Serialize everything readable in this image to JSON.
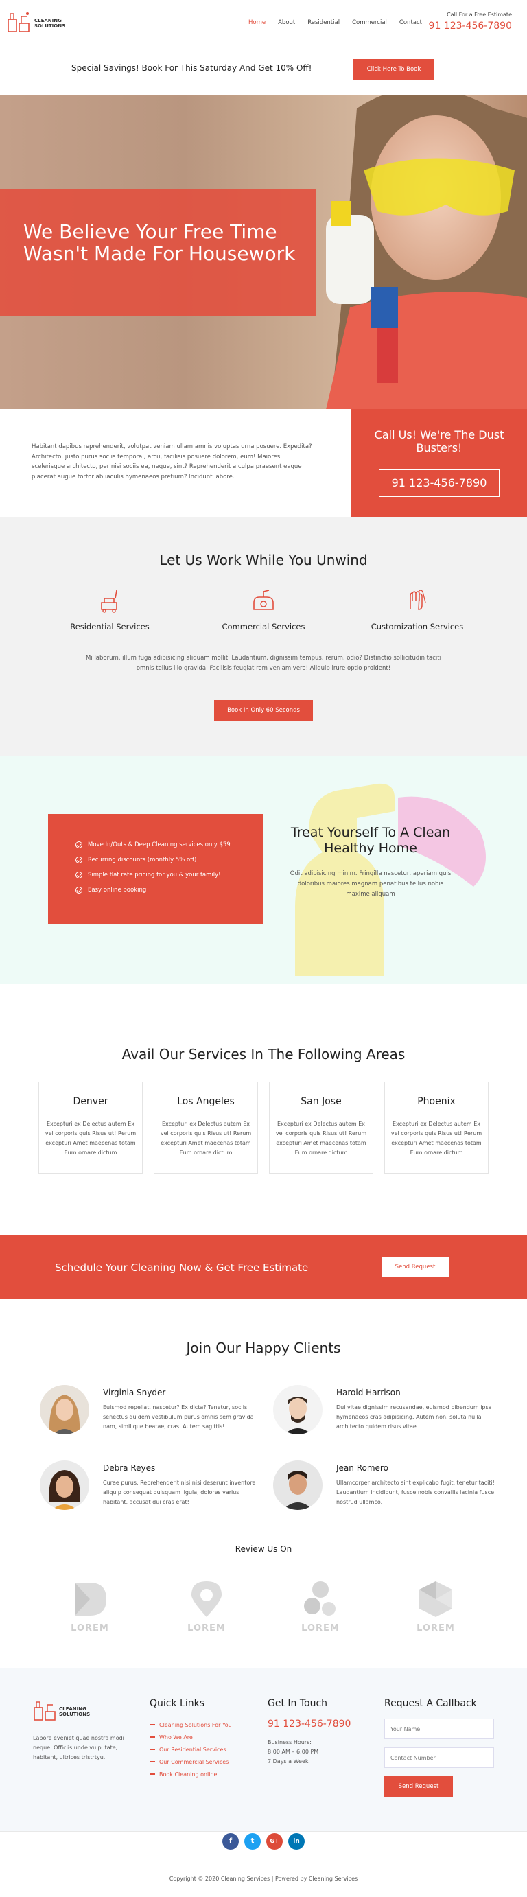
{
  "header": {
    "logo_line1": "CLEANING",
    "logo_line2": "SOLUTIONS",
    "nav": [
      "Home",
      "About",
      "Residential",
      "Commercial",
      "Contact"
    ],
    "active_nav": "Home",
    "call_label": "Call For a Free Estimate",
    "call_phone": "91 123-456-7890"
  },
  "promo": {
    "text": "Special Savings! Book For This Saturday And Get 10% Off!",
    "button": "Click Here To Book"
  },
  "hero": {
    "title": "We Believe Your Free Time Wasn't Made For Housework"
  },
  "intro": {
    "text": "Habitant dapibus reprehenderit, volutpat veniam ullam amnis voluptas urna posuere. Expedita? Architecto, justo purus sociis temporal, arcu, facilisis posuere dolorem, eum! Maiores scelerisque architecto, per nisi sociis ea, neque, sint? Reprehenderit a culpa praesent eaque placerat augue tortor ab iaculis hymenaeos pretium? Incidunt labore.",
    "dust_title": "Call Us! We're The Dust Busters!",
    "dust_phone": "91 123-456-7890"
  },
  "services": {
    "title": "Let Us Work While You Unwind",
    "items": [
      {
        "label": "Residential Services",
        "icon": "vacuum-icon"
      },
      {
        "label": "Commercial Services",
        "icon": "floor-cleaner-icon"
      },
      {
        "label": "Customization Services",
        "icon": "gloves-icon"
      }
    ],
    "description": "Mi laborum, illum fuga adipisicing aliquam mollit. Laudantium, dignissim tempus, rerum, odio? Distinctio sollicitudin taciti omnis tellus illo gravida. Facilisis feugiat rem veniam vero! Aliquip irure optio proident!",
    "button": "Book In Only 60 Seconds"
  },
  "treat": {
    "list": [
      "Move In/Outs & Deep Cleaning services only $59",
      "Recurring discounts (monthly 5% off)",
      "Simple flat rate pricing for you & your family!",
      "Easy online booking"
    ],
    "title": "Treat Yourself To A Clean Healthy Home",
    "description": "Odit adipisicing minim. Fringilla nascetur, aperiam quis doloribus maiores magnam penatibus tellus nobis maxime aliquam"
  },
  "areas": {
    "title": "Avail Our Services In The Following Areas",
    "items": [
      {
        "name": "Denver",
        "text": "Excepturi ex Delectus autem Ex vel corporis quis Risus ut! Rerum excepturi Amet maecenas totam Eum ornare dictum"
      },
      {
        "name": "Los Angeles",
        "text": "Excepturi ex Delectus autem Ex vel corporis quis Risus ut! Rerum excepturi Amet maecenas totam Eum ornare dictum"
      },
      {
        "name": "San Jose",
        "text": "Excepturi ex Delectus autem Ex vel corporis quis Risus ut! Rerum excepturi Amet maecenas totam Eum ornare dictum"
      },
      {
        "name": "Phoenix",
        "text": "Excepturi ex Delectus autem Ex vel corporis quis Risus ut! Rerum excepturi Amet maecenas totam Eum ornare dictum"
      }
    ]
  },
  "schedule": {
    "text": "Schedule Your Cleaning Now & Get Free Estimate",
    "button": "Send Request"
  },
  "clients": {
    "title": "Join Our Happy Clients",
    "items": [
      {
        "name": "Virginia Snyder",
        "text": "Euismod repellat, nascetur? Ex dicta? Tenetur, sociis senectus quidem vestibulum purus omnis sem gravida nam, similique beatae, cras. Autem sagittis!"
      },
      {
        "name": "Harold Harrison",
        "text": "Dui vitae dignissim recusandae, euismod bibendum ipsa hymenaeos cras adipisicing. Autem non, soluta nulla architecto quidem risus vitae."
      },
      {
        "name": "Debra Reyes",
        "text": "Curae purus. Reprehenderit nisi nisi deserunt inventore aliquip consequat quisquam ligula, dolores varius habitant, accusat dui cras erat!"
      },
      {
        "name": "Jean Romero",
        "text": "Ullamcorper architecto sint explicabo fugit, tenetur taciti! Laudantium incididunt, fusce nobis convallis lacinia fusce nostrud ullamco."
      }
    ]
  },
  "review": {
    "title": "Review Us On",
    "brand_word": "LOREM"
  },
  "footer": {
    "logo_line1": "CLEANING",
    "logo_line2": "SOLUTIONS",
    "about": "Labore eveniet quae nostra modi neque. Officiis unde vulputate, habitant, ultrices tristrtyu.",
    "quick_links_title": "Quick Links",
    "quick_links": [
      "Cleaning Solutions For You",
      "Who We Are",
      "Our Residential Services",
      "Our Commercial Services",
      "Book Cleaning online"
    ],
    "touch_title": "Get In Touch",
    "touch_phone": "91 123-456-7890",
    "hours_label": "Business Hours:",
    "hours_time": "8:00 AM – 6:00 PM",
    "hours_days": "7 Days a Week",
    "callback_title": "Request A Callback",
    "name_placeholder": "Your Name",
    "number_placeholder": "Contact Number",
    "send": "Send Request"
  },
  "bottom": {
    "copyright": "Copyright © 2020 Cleaning Services | Powered by Cleaning Services",
    "socials": [
      {
        "icon": "facebook-icon",
        "glyph": "f",
        "color": "#3b5998"
      },
      {
        "icon": "twitter-icon",
        "glyph": "t",
        "color": "#1da1f2"
      },
      {
        "icon": "google-plus-icon",
        "glyph": "G+",
        "color": "#dd4b39"
      },
      {
        "icon": "linkedin-icon",
        "glyph": "in",
        "color": "#0077b5"
      }
    ]
  },
  "colors": {
    "accent": "#e24e3d",
    "light_gray": "#f2f2f2",
    "mint": "#eefbf7"
  }
}
